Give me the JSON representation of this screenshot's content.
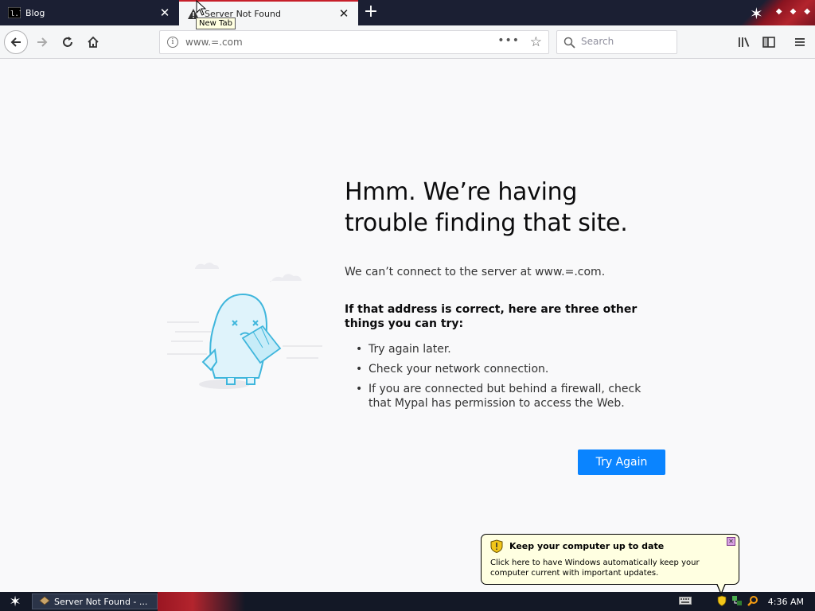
{
  "browser": {
    "tabs": [
      {
        "title": "Blog",
        "active": false
      },
      {
        "title": "Server Not Found",
        "active": true
      }
    ],
    "tooltip": "New Tab",
    "url": "www.=.com",
    "search_placeholder": "Search"
  },
  "error_page": {
    "title": "Hmm. We’re having trouble finding that site.",
    "description": "We can’t connect to the server at www.=.com.",
    "tips_heading": "If that address is correct, here are three other things you can try:",
    "tips": [
      "Try again later.",
      "Check your network connection.",
      "If you are connected but behind a firewall, check that Mypal has permission to access the Web."
    ],
    "button": "Try Again"
  },
  "notification": {
    "title": "Keep your computer up to date",
    "body": "Click here to have Windows automatically keep your computer current with important updates."
  },
  "taskbar": {
    "task": "Server Not Found - ...",
    "clock": "4:36 AM"
  },
  "colors": {
    "accent": "#0a84ff",
    "tab_highlight": "#c71f2a",
    "tabstrip": "#1b1f33",
    "taskbar": "#131826",
    "balloon": "#ffffe1"
  },
  "icons": [
    "back-arrow-icon",
    "forward-arrow-icon",
    "reload-icon",
    "home-icon",
    "info-icon",
    "page-actions-icon",
    "bookmark-star-icon",
    "search-icon",
    "library-icon",
    "sidebar-icon",
    "menu-icon",
    "warning-icon",
    "close-icon",
    "new-tab-icon",
    "shield-icon",
    "start-star-icon"
  ]
}
